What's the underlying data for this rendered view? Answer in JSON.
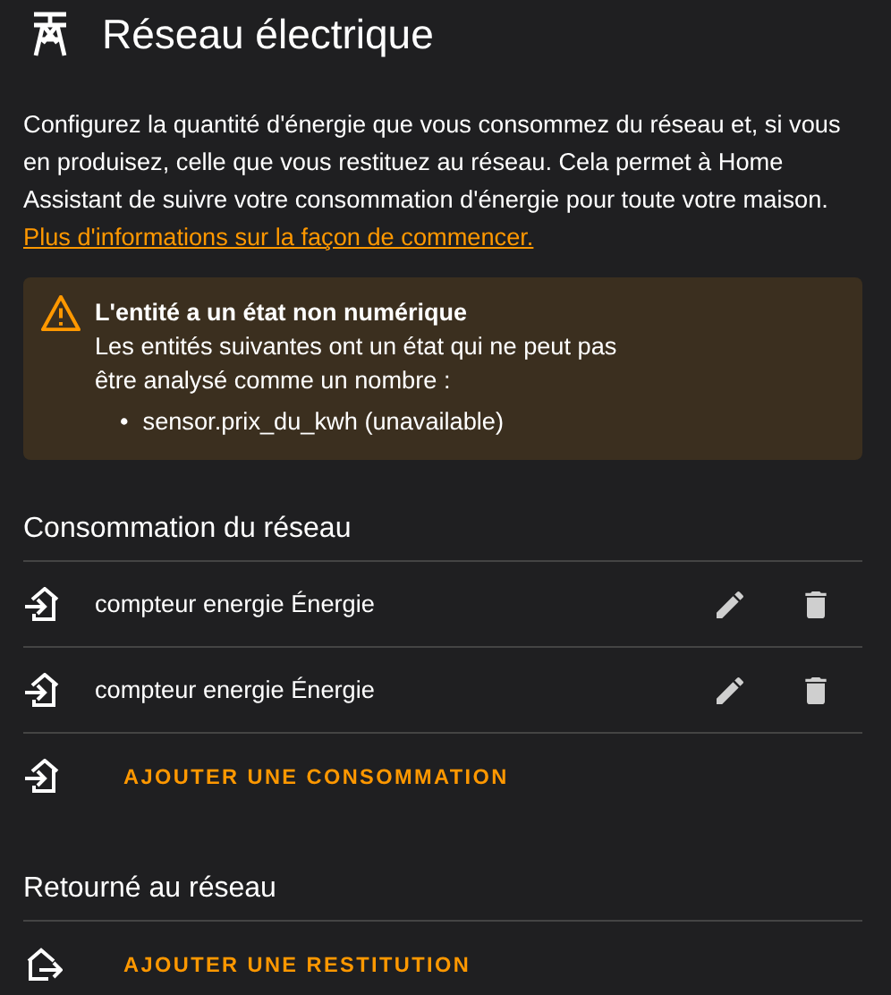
{
  "header": {
    "title": "Réseau électrique"
  },
  "description": "Configurez la quantité d'énergie que vous consommez du réseau et, si vous en produisez, celle que vous restituez au réseau. Cela permet à Home Assistant de suivre votre consommation d'énergie pour toute votre maison.",
  "link": "Plus d'informations sur la façon de commencer.",
  "warning": {
    "title": "L'entité a un état non numérique",
    "message": "Les entités suivantes ont un état qui ne peut pas être analysé comme un nombre :",
    "items": [
      {
        "bullet": "•",
        "text": "sensor.prix_du_kwh (unavailable)"
      }
    ]
  },
  "sections": [
    {
      "title": "Consommation du réseau",
      "kind": "import",
      "entries": [
        {
          "name": "compteur energie Énergie"
        },
        {
          "name": "compteur energie Énergie"
        }
      ],
      "add_label": "AJOUTER UNE CONSOMMATION"
    },
    {
      "title": "Retourné au réseau",
      "kind": "export",
      "add_label": "AJOUTER UNE RESTITUTION"
    }
  ]
}
